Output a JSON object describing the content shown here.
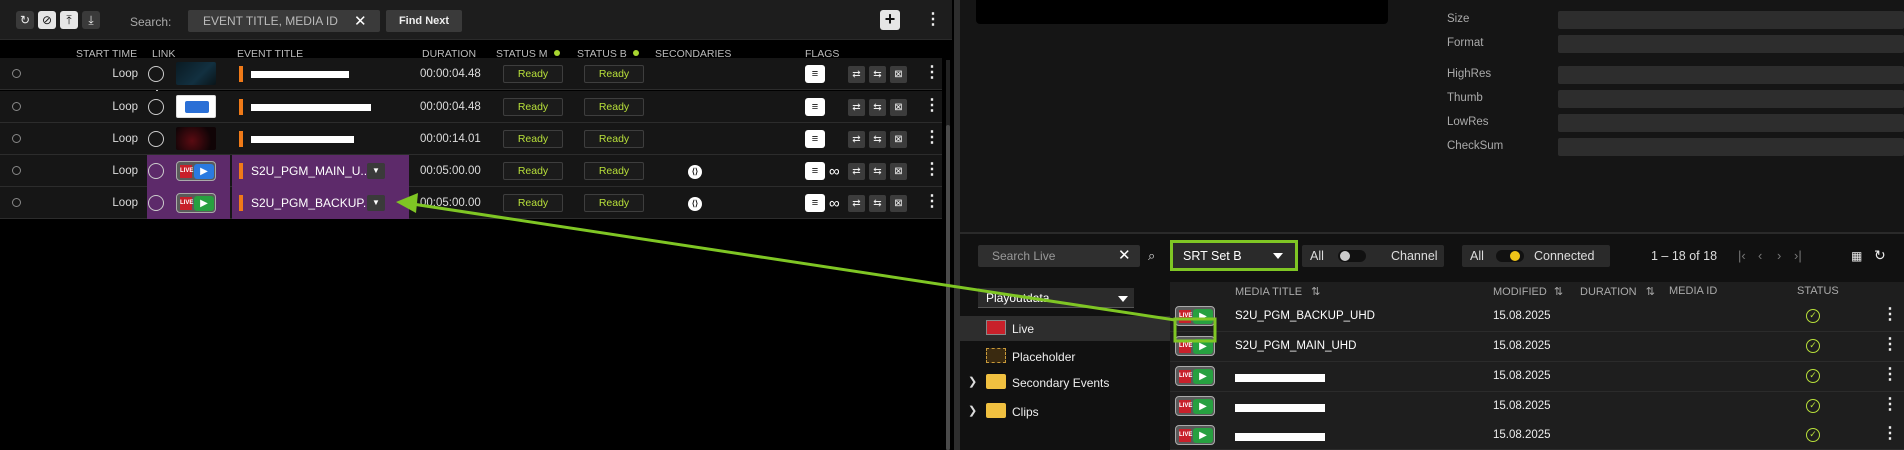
{
  "toolbar": {
    "search_label": "Search:",
    "search_placeholder": "EVENT TITLE, MEDIA ID",
    "find_next": "Find Next",
    "icons": [
      "refresh-icon",
      "no-sync-icon",
      "align-top-icon",
      "download-icon"
    ]
  },
  "playlist": {
    "columns": {
      "start_time": "START TIME",
      "link": "LINK",
      "event_title": "EVENT TITLE",
      "duration": "DURATION",
      "status_m": "STATUS M",
      "status_b": "STATUS B",
      "secondaries": "SECONDARIES",
      "flags": "FLAGS"
    },
    "rows": [
      {
        "start": "Loop",
        "title": "",
        "duration": "00:00:04.48",
        "status_m": "Ready",
        "status_b": "Ready"
      },
      {
        "start": "Loop",
        "title": "",
        "duration": "00:00:04.48",
        "status_m": "Ready",
        "status_b": "Ready"
      },
      {
        "start": "Loop",
        "title": "",
        "duration": "00:00:14.01",
        "status_m": "Ready",
        "status_b": "Ready"
      },
      {
        "start": "Loop",
        "title": "S2U_PGM_MAIN_U...",
        "duration": "00:05:00.00",
        "status_m": "Ready",
        "status_b": "Ready"
      },
      {
        "start": "Loop",
        "title": "S2U_PGM_BACKUP...",
        "duration": "00:05:00.00",
        "status_m": "Ready",
        "status_b": "Ready"
      }
    ]
  },
  "metadata": {
    "labels": {
      "size": "Size",
      "format": "Format",
      "highres": "HighRes",
      "thumb": "Thumb",
      "lowres": "LowRes",
      "checksum": "CheckSum"
    }
  },
  "browser": {
    "search_placeholder": "Search Live",
    "set_select": "SRT Set B",
    "filter_all_1": "All",
    "filter_channel": "Channel",
    "filter_all_2": "All",
    "filter_connected": "Connected",
    "pager": "1 – 18 of 18",
    "tree_select": "Playoutdata",
    "tree": [
      {
        "label": "Live"
      },
      {
        "label": "Placeholder"
      },
      {
        "label": "Secondary Events"
      },
      {
        "label": "Clips"
      }
    ],
    "columns": {
      "media_title": "MEDIA TITLE",
      "modified": "MODIFIED",
      "duration": "DURATION",
      "media_id": "MEDIA ID",
      "status": "STATUS"
    },
    "rows": [
      {
        "title": "S2U_PGM_BACKUP_UHD",
        "modified": "15.08.2025"
      },
      {
        "title": "S2U_PGM_MAIN_UHD",
        "modified": "15.08.2025"
      },
      {
        "title": "",
        "modified": "15.08.2025"
      },
      {
        "title": "",
        "modified": "15.08.2025"
      },
      {
        "title": "",
        "modified": "15.08.2025"
      }
    ]
  },
  "colors": {
    "accent_green": "#7fc624",
    "ready_green": "#b8e03a",
    "event_orange": "#f07a18",
    "selected_purple": "#5d2a6a",
    "live_red": "#c8202a"
  }
}
